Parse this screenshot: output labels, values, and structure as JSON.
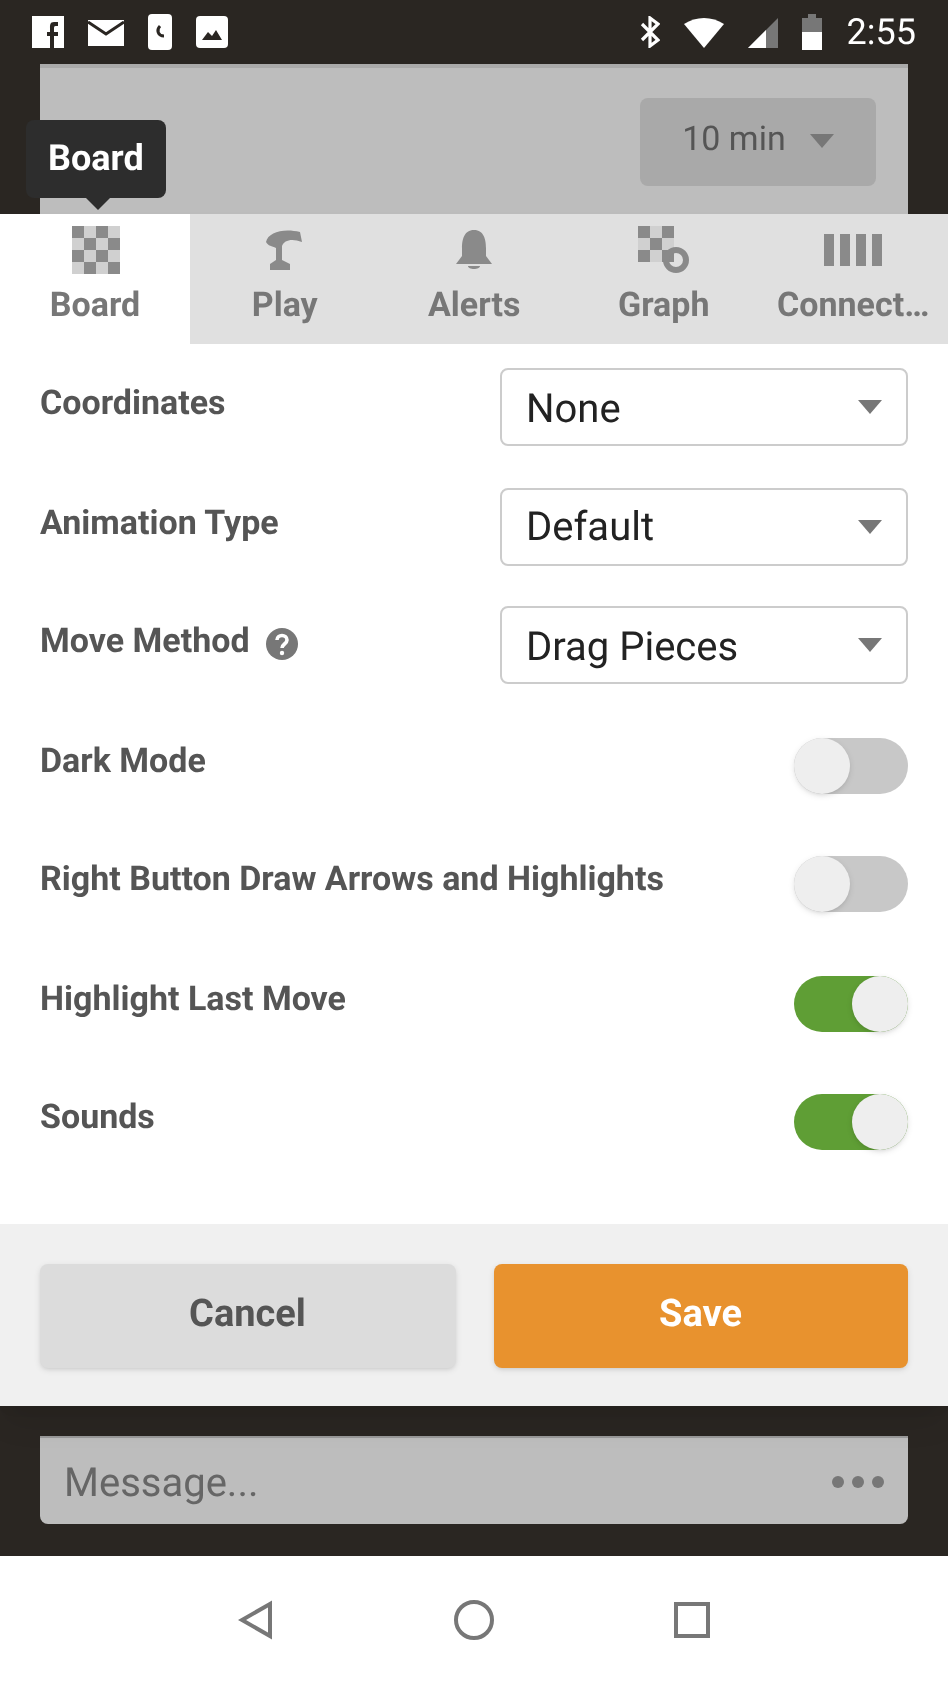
{
  "status_bar": {
    "time": "2:55"
  },
  "background": {
    "time_select": "10 min",
    "message_placeholder": "Message..."
  },
  "tooltip": {
    "text": "Board"
  },
  "tabs": [
    {
      "label": "Board",
      "selected": true,
      "kind": "board"
    },
    {
      "label": "Play",
      "selected": false,
      "kind": "play"
    },
    {
      "label": "Alerts",
      "selected": false,
      "kind": "alerts"
    },
    {
      "label": "Graph",
      "selected": false,
      "kind": "graph"
    },
    {
      "label": "Connect…",
      "selected": false,
      "kind": "connect"
    }
  ],
  "settings": [
    {
      "kind": "select",
      "label": "Coordinates",
      "value": "None"
    },
    {
      "kind": "select",
      "label": "Animation Type",
      "value": "Default"
    },
    {
      "kind": "select",
      "label": "Move Method",
      "value": "Drag Pieces",
      "help": true
    },
    {
      "kind": "toggle",
      "label": "Dark Mode",
      "on": false
    },
    {
      "kind": "toggle",
      "label": "Right Button Draw Arrows and Highlights",
      "on": false
    },
    {
      "kind": "toggle",
      "label": "Highlight Last Move",
      "on": true
    },
    {
      "kind": "toggle",
      "label": "Sounds",
      "on": true
    }
  ],
  "buttons": [
    {
      "kind": "cancel",
      "label": "Cancel"
    },
    {
      "kind": "save",
      "label": "Save"
    }
  ]
}
